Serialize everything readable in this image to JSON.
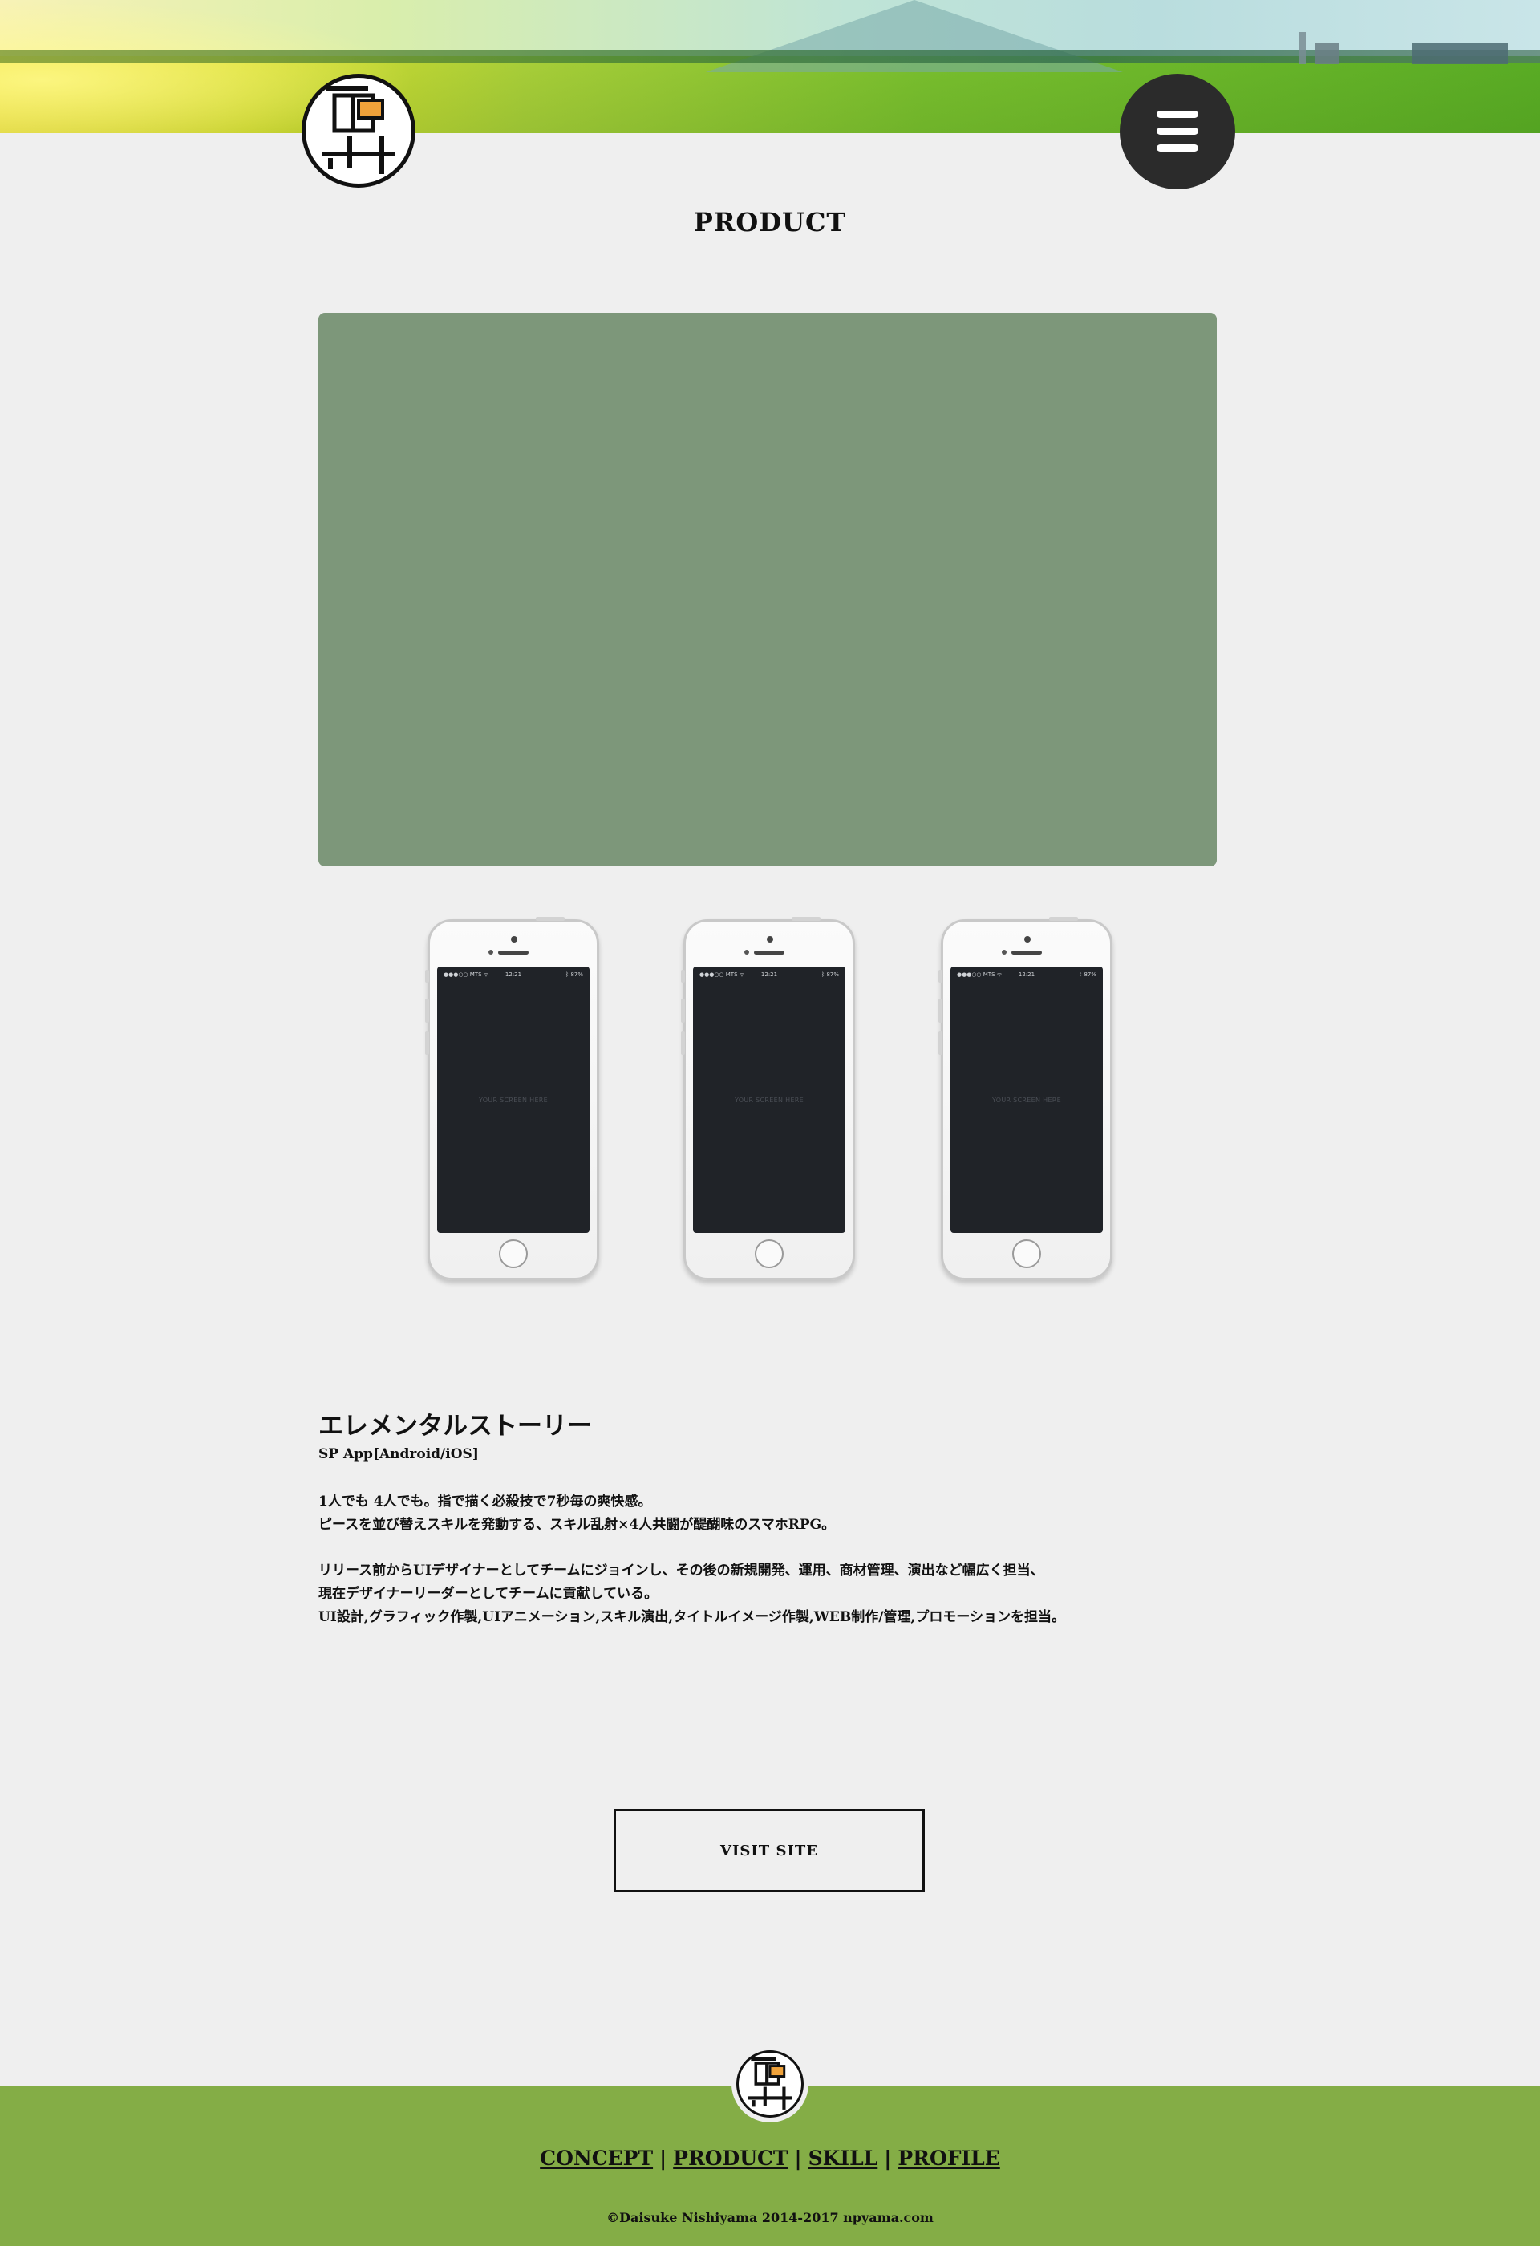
{
  "header": {
    "logo_icon": "nishiyama-kanji-logo-icon",
    "menu_icon": "hamburger-menu-icon"
  },
  "section": {
    "title": "PRODUCT"
  },
  "slideshow": {
    "background_color": "#7d977a"
  },
  "phones": [
    {
      "status_left": "●●●○○ MTS  ᯤ",
      "status_time": "12:21",
      "status_right": "ᛒ 87%",
      "placeholder": "YOUR SCREEN HERE"
    },
    {
      "status_left": "●●●○○ MTS  ᯤ",
      "status_time": "12:21",
      "status_right": "ᛒ 87%",
      "placeholder": "YOUR SCREEN HERE"
    },
    {
      "status_left": "●●●○○ MTS  ᯤ",
      "status_time": "12:21",
      "status_right": "ᛒ 87%",
      "placeholder": "YOUR SCREEN HERE"
    }
  ],
  "product": {
    "name": "エレメンタルストーリー",
    "platform": "SP App[Android/iOS]",
    "catch_lines": [
      "1人でも 4人でも。指で描く必殺技で7秒毎の爽快感。",
      "ピースを並び替えスキルを発動する、スキル乱射×4人共闘が醍醐味のスマホRPG。"
    ],
    "role_lines": [
      "リリース前からUIデザイナーとしてチームにジョインし、その後の新規開発、運用、商材管理、演出など幅広く担当、",
      "現在デザイナーリーダーとしてチームに貢献している。",
      "UI設計,グラフィック作製,UIアニメーション,スキル演出,タイトルイメージ作製,WEB制作/管理,プロモーションを担当。"
    ]
  },
  "visit_button": {
    "label": "VISIT SITE"
  },
  "footer": {
    "nav": [
      "CONCEPT",
      "PRODUCT",
      "SKILL",
      "PROFILE"
    ],
    "separator": "|",
    "copyright": "©Daisuke Nishiyama 2014-2017 npyama.com",
    "background_color": "#84ad46"
  }
}
